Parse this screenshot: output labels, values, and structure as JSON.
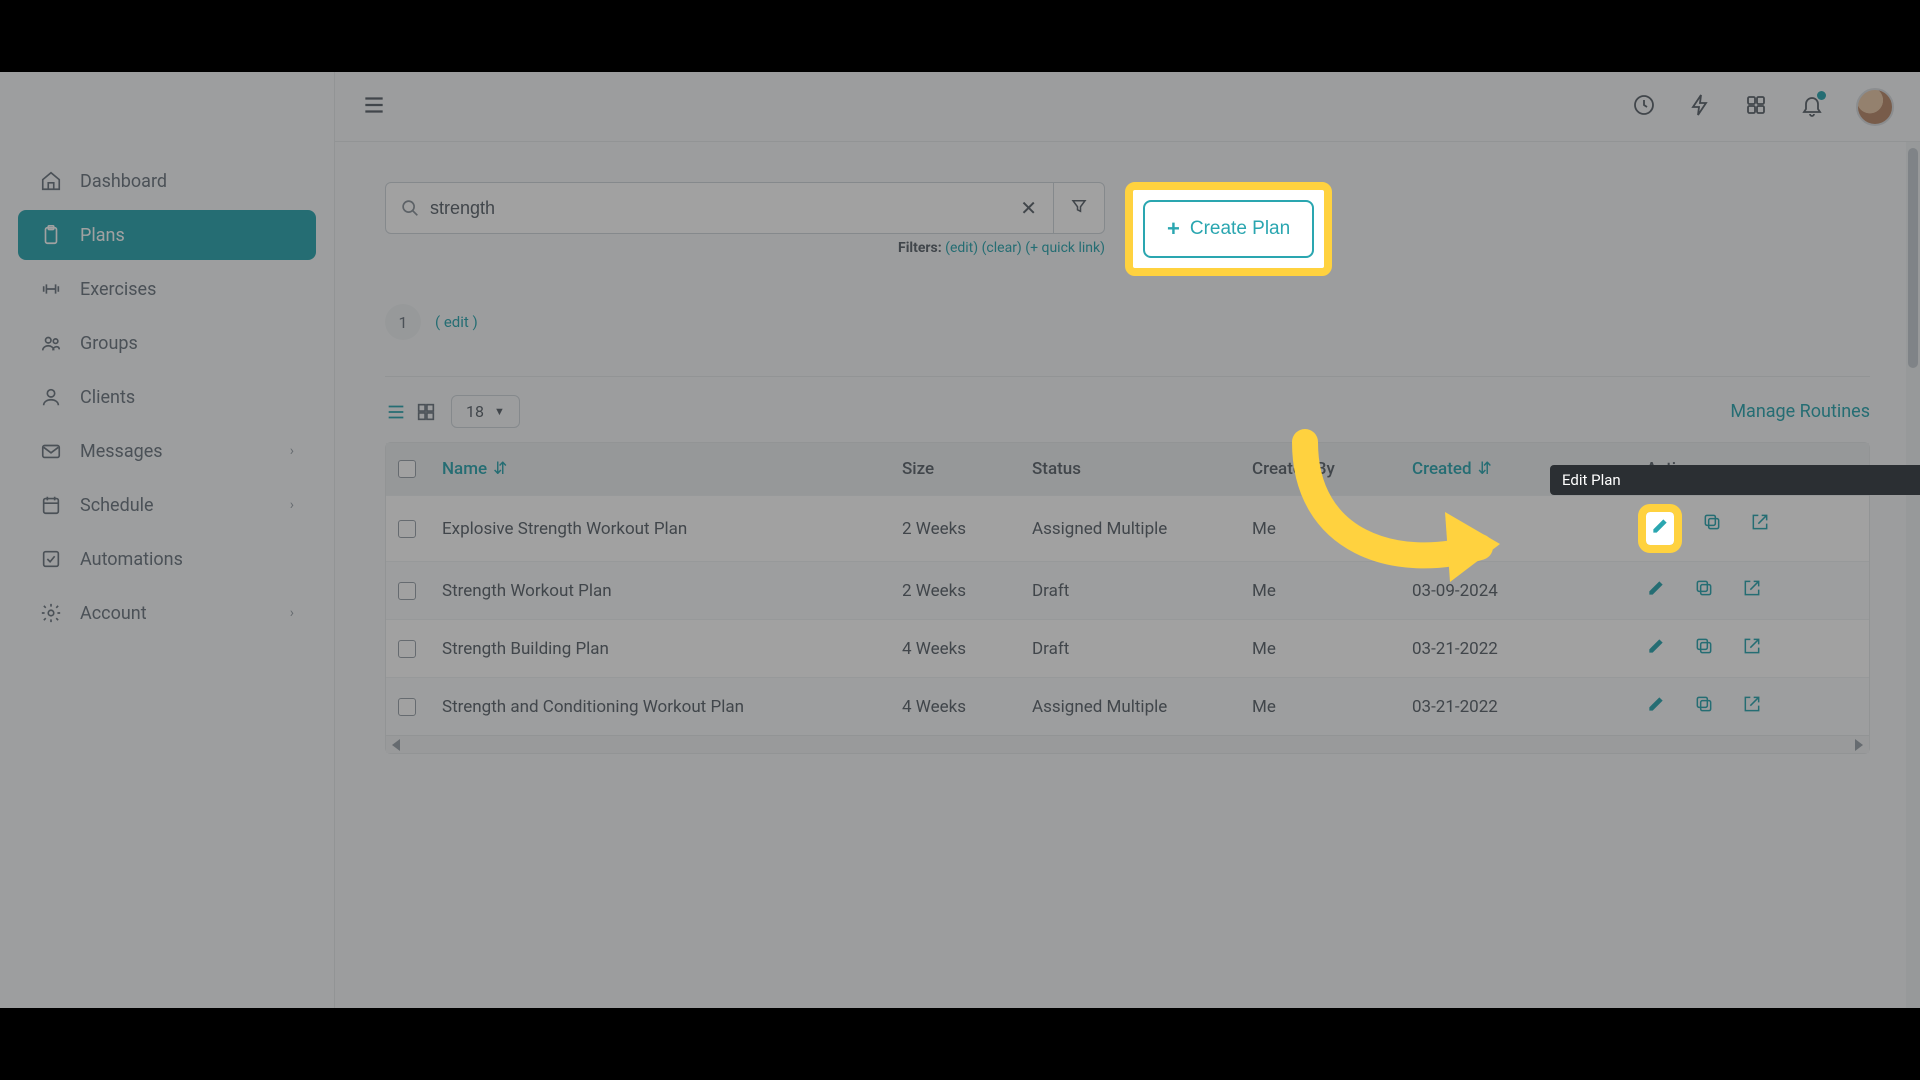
{
  "sidebar": {
    "items": [
      {
        "label": "Dashboard",
        "chev": false
      },
      {
        "label": "Plans",
        "chev": false
      },
      {
        "label": "Exercises",
        "chev": false
      },
      {
        "label": "Groups",
        "chev": false
      },
      {
        "label": "Clients",
        "chev": false
      },
      {
        "label": "Messages",
        "chev": true
      },
      {
        "label": "Schedule",
        "chev": true
      },
      {
        "label": "Automations",
        "chev": false
      },
      {
        "label": "Account",
        "chev": true
      }
    ],
    "active_index": 1
  },
  "search": {
    "value": "strength",
    "filters_label": "Filters:",
    "edit": "(edit)",
    "clear": "(clear)",
    "quick": "(+ quick link)"
  },
  "create_button": "Create Plan",
  "pagination": {
    "page": "1",
    "edit": "( edit )"
  },
  "page_size": "18",
  "manage_link": "Manage Routines",
  "columns": {
    "name": "Name",
    "size": "Size",
    "status": "Status",
    "created_by": "Created By",
    "created": "Created",
    "actions": "Actions"
  },
  "rows": [
    {
      "name": "Explosive Strength Workout Plan",
      "size": "2 Weeks",
      "status": "Assigned Multiple",
      "created_by": "Me",
      "created": ""
    },
    {
      "name": "Strength Workout Plan",
      "size": "2 Weeks",
      "status": "Draft",
      "created_by": "Me",
      "created": "03-09-2024"
    },
    {
      "name": "Strength Building Plan",
      "size": "4 Weeks",
      "status": "Draft",
      "created_by": "Me",
      "created": "03-21-2022"
    },
    {
      "name": "Strength and Conditioning Workout Plan",
      "size": "4 Weeks",
      "status": "Assigned Multiple",
      "created_by": "Me",
      "created": "03-21-2022"
    }
  ],
  "tooltip": "Edit Plan",
  "colors": {
    "accent": "#2aa6b0",
    "highlight": "#ffd23f"
  }
}
